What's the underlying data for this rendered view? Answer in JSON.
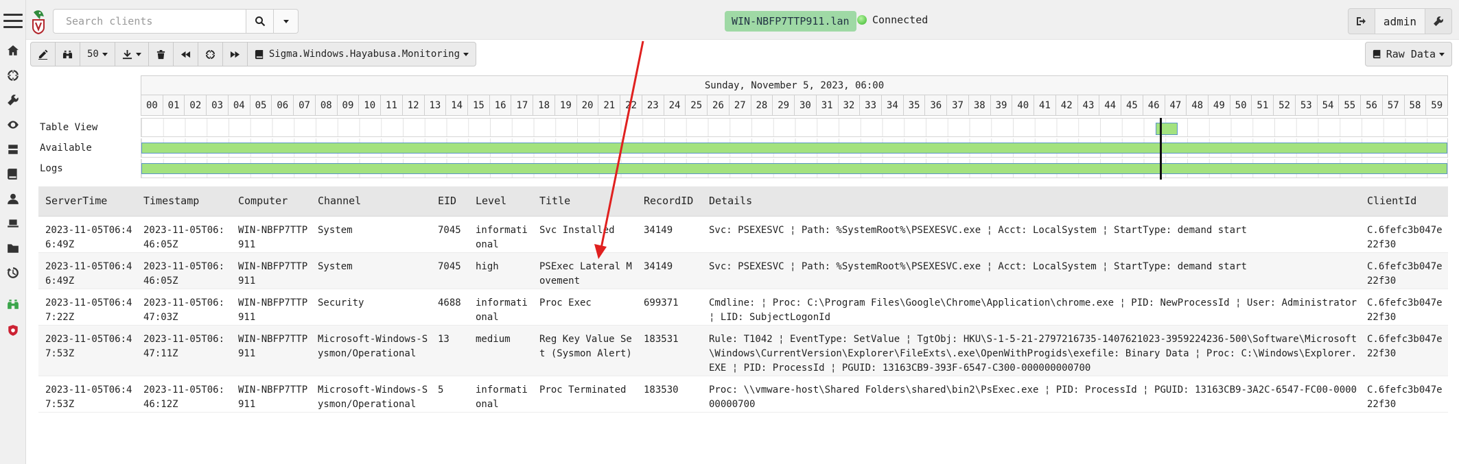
{
  "app": {
    "search": {
      "placeholder": "Search clients",
      "value": ""
    },
    "hostname": "WIN-NBFP7TTP911.lan",
    "connection_status": "Connected",
    "user": "admin"
  },
  "toolbar": {
    "page_size": "50",
    "artifact": "Sigma.Windows.Hayabusa.Monitoring",
    "raw_data_label": "Raw Data"
  },
  "timeline": {
    "date_label": "Sunday, November 5, 2023, 06:00",
    "minutes": [
      "00",
      "01",
      "02",
      "03",
      "04",
      "05",
      "06",
      "07",
      "08",
      "09",
      "10",
      "11",
      "12",
      "13",
      "14",
      "15",
      "16",
      "17",
      "18",
      "19",
      "20",
      "21",
      "22",
      "23",
      "24",
      "25",
      "26",
      "27",
      "28",
      "29",
      "30",
      "31",
      "32",
      "33",
      "34",
      "35",
      "36",
      "37",
      "38",
      "39",
      "40",
      "41",
      "42",
      "43",
      "44",
      "45",
      "46",
      "47",
      "48",
      "49",
      "50",
      "51",
      "52",
      "53",
      "54",
      "55",
      "56",
      "57",
      "58",
      "59"
    ],
    "rows": [
      {
        "label": "Table View"
      },
      {
        "label": "Available"
      },
      {
        "label": "Logs"
      }
    ]
  },
  "table": {
    "columns": [
      "ServerTime",
      "Timestamp",
      "Computer",
      "Channel",
      "EID",
      "Level",
      "Title",
      "RecordID",
      "Details",
      "ClientId"
    ],
    "rows": [
      [
        "2023-11-05T06:46:49Z",
        "2023-11-05T06:46:05Z",
        "WIN-NBFP7TTP911",
        "System",
        "7045",
        "informational",
        "Svc Installed",
        "34149",
        "Svc: PSEXESVC ¦ Path: %SystemRoot%\\PSEXESVC.exe ¦ Acct: LocalSystem ¦ StartType: demand start",
        "C.6fefc3b047e22f30"
      ],
      [
        "2023-11-05T06:46:49Z",
        "2023-11-05T06:46:05Z",
        "WIN-NBFP7TTP911",
        "System",
        "7045",
        "high",
        "PSExec Lateral Movement",
        "34149",
        "Svc: PSEXESVC ¦ Path: %SystemRoot%\\PSEXESVC.exe ¦ Acct: LocalSystem ¦ StartType: demand start",
        "C.6fefc3b047e22f30"
      ],
      [
        "2023-11-05T06:47:22Z",
        "2023-11-05T06:47:03Z",
        "WIN-NBFP7TTP911",
        "Security",
        "4688",
        "informational",
        "Proc Exec",
        "699371",
        "Cmdline: ¦ Proc: C:\\Program Files\\Google\\Chrome\\Application\\chrome.exe ¦ PID: NewProcessId ¦ User: Administrator ¦ LID: SubjectLogonId",
        "C.6fefc3b047e22f30"
      ],
      [
        "2023-11-05T06:47:53Z",
        "2023-11-05T06:47:11Z",
        "WIN-NBFP7TTP911",
        "Microsoft-Windows-Sysmon/Operational",
        "13",
        "medium",
        "Reg Key Value Set (Sysmon Alert)",
        "183531",
        "Rule: T1042 ¦ EventType: SetValue ¦ TgtObj: HKU\\S-1-5-21-2797216735-1407621023-3959224236-500\\Software\\Microsoft\\Windows\\CurrentVersion\\Explorer\\FileExts\\.exe\\OpenWithProgids\\exefile: Binary Data ¦ Proc: C:\\Windows\\Explorer.EXE ¦ PID: ProcessId ¦ PGUID: 13163CB9-393F-6547-C300-000000000700",
        "C.6fefc3b047e22f30"
      ],
      [
        "2023-11-05T06:47:53Z",
        "2023-11-05T06:46:12Z",
        "WIN-NBFP7TTP911",
        "Microsoft-Windows-Sysmon/Operational",
        "5",
        "informational",
        "Proc Terminated",
        "183530",
        "Proc: \\\\vmware-host\\Shared Folders\\shared\\bin2\\PsExec.exe ¦ PID: ProcessId ¦ PGUID: 13163CB9-3A2C-6547-FC00-000000000700",
        "C.6fefc3b047e22f30"
      ]
    ]
  },
  "colors": {
    "accent_green": "#9fd9a5",
    "timeline_fill": "#a3e27f",
    "annotation_arrow": "#e0201f"
  }
}
